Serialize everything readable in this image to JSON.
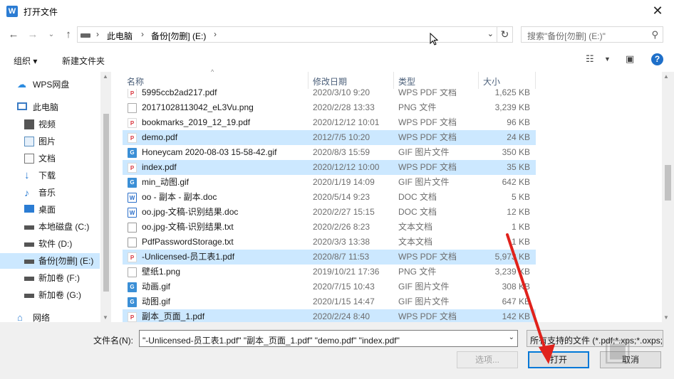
{
  "title": "打开文件",
  "address": {
    "crumbs": [
      "此电脑",
      "备份[勿删] (E:)"
    ],
    "search_placeholder": "搜索\"备份[勿删] (E:)\""
  },
  "toolbar": {
    "organize": "组织 ▾",
    "new_folder": "新建文件夹"
  },
  "sidebar": [
    {
      "label": "WPS网盘",
      "icon": "cloud-icon"
    },
    {
      "label": "此电脑",
      "icon": "computer-icon"
    },
    {
      "label": "视频",
      "icon": "video-icon"
    },
    {
      "label": "图片",
      "icon": "picture-icon"
    },
    {
      "label": "文档",
      "icon": "document-icon"
    },
    {
      "label": "下载",
      "icon": "download-icon"
    },
    {
      "label": "音乐",
      "icon": "music-icon"
    },
    {
      "label": "桌面",
      "icon": "desktop-icon"
    },
    {
      "label": "本地磁盘 (C:)",
      "icon": "drive-icon"
    },
    {
      "label": "软件 (D:)",
      "icon": "drive-icon"
    },
    {
      "label": "备份[勿删] (E:)",
      "icon": "drive-icon"
    },
    {
      "label": "新加卷 (F:)",
      "icon": "drive-icon"
    },
    {
      "label": "新加卷 (G:)",
      "icon": "drive-icon"
    },
    {
      "label": "网络",
      "icon": "network-icon"
    }
  ],
  "columns": {
    "name": "名称",
    "date": "修改日期",
    "type": "类型",
    "size": "大小"
  },
  "files": [
    {
      "name": "5995ccb2ad217.pdf",
      "date": "2020/3/10 9:20",
      "type": "WPS PDF 文档",
      "size": "1,625 KB",
      "kind": "pdf",
      "selected": false
    },
    {
      "name": "20171028113042_eL3Vu.png",
      "date": "2020/2/28 13:33",
      "type": "PNG 文件",
      "size": "3,239 KB",
      "kind": "png",
      "selected": false
    },
    {
      "name": "bookmarks_2019_12_19.pdf",
      "date": "2020/12/12 10:01",
      "type": "WPS PDF 文档",
      "size": "96 KB",
      "kind": "pdf",
      "selected": false
    },
    {
      "name": "demo.pdf",
      "date": "2012/7/5 10:20",
      "type": "WPS PDF 文档",
      "size": "24 KB",
      "kind": "pdf",
      "selected": true
    },
    {
      "name": "Honeycam 2020-08-03 15-58-42.gif",
      "date": "2020/8/3 15:59",
      "type": "GIF 图片文件",
      "size": "350 KB",
      "kind": "gif",
      "selected": false
    },
    {
      "name": "index.pdf",
      "date": "2020/12/12 10:00",
      "type": "WPS PDF 文档",
      "size": "35 KB",
      "kind": "pdf",
      "selected": true
    },
    {
      "name": "min_动图.gif",
      "date": "2020/1/19 14:09",
      "type": "GIF 图片文件",
      "size": "642 KB",
      "kind": "gif",
      "selected": false
    },
    {
      "name": "oo - 副本 - 副本.doc",
      "date": "2020/5/14 9:23",
      "type": "DOC 文档",
      "size": "5 KB",
      "kind": "doc",
      "selected": false
    },
    {
      "name": "oo.jpg-文稿-识别结果.doc",
      "date": "2020/2/27 15:15",
      "type": "DOC 文档",
      "size": "12 KB",
      "kind": "doc",
      "selected": false
    },
    {
      "name": "oo.jpg-文稿-识别结果.txt",
      "date": "2020/2/26 8:23",
      "type": "文本文档",
      "size": "1 KB",
      "kind": "txt",
      "selected": false
    },
    {
      "name": "PdfPasswordStorage.txt",
      "date": "2020/3/3 13:38",
      "type": "文本文档",
      "size": "1 KB",
      "kind": "txt",
      "selected": false
    },
    {
      "name": "-Unlicensed-员工表1.pdf",
      "date": "2020/8/7 11:53",
      "type": "WPS PDF 文档",
      "size": "5,973 KB",
      "kind": "pdf",
      "selected": true
    },
    {
      "name": "壁纸1.png",
      "date": "2019/10/21 17:36",
      "type": "PNG 文件",
      "size": "3,239 KB",
      "kind": "png",
      "selected": false
    },
    {
      "name": "动画.gif",
      "date": "2020/7/15 10:43",
      "type": "GIF 图片文件",
      "size": "308 KB",
      "kind": "gif",
      "selected": false
    },
    {
      "name": "动图.gif",
      "date": "2020/1/15 14:47",
      "type": "GIF 图片文件",
      "size": "647 KB",
      "kind": "gif",
      "selected": false
    },
    {
      "name": "副本_页面_1.pdf",
      "date": "2020/2/24 8:40",
      "type": "WPS PDF 文档",
      "size": "142 KB",
      "kind": "pdf",
      "selected": true
    }
  ],
  "footer": {
    "filename_label": "文件名(N):",
    "filename_value": "\"-Unlicensed-员工表1.pdf\" \"副本_页面_1.pdf\" \"demo.pdf\" \"index.pdf\"",
    "filetype_value": "所有支持的文件 (*.pdf;*.xps;*.oxps;*.",
    "options_button": "选项...",
    "open_button": "打开",
    "cancel_button": "取消"
  }
}
